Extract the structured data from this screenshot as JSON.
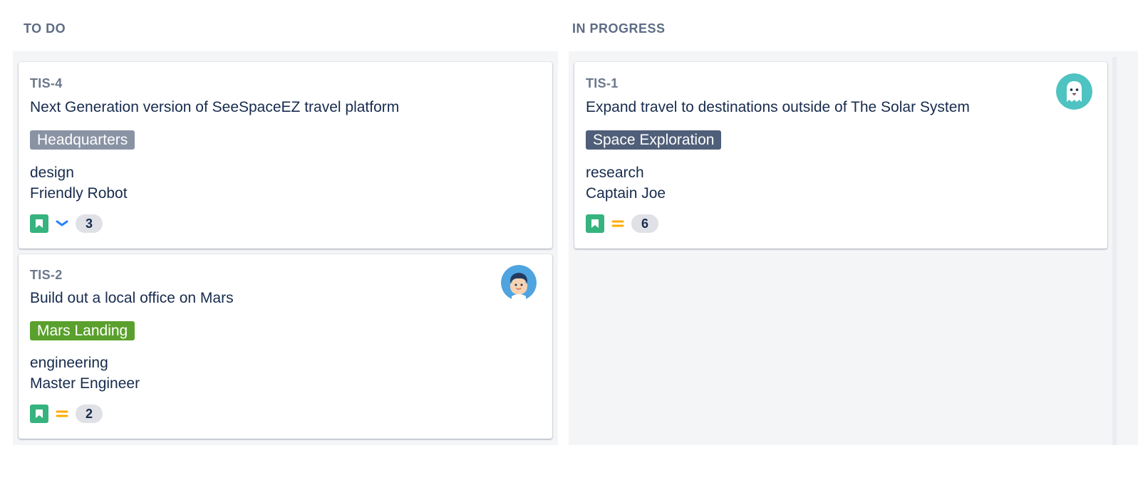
{
  "columns": [
    {
      "title": "TO DO",
      "cards": [
        {
          "key": "TIS-4",
          "summary": "Next Generation version of SeeSpaceEZ travel platform",
          "epic": "Headquarters",
          "epic_color": "#8993a4",
          "component": "design",
          "team": "Friendly Robot",
          "issue_type_icon": "story-icon",
          "priority_icon": "priority-low-icon",
          "estimate": "3"
        },
        {
          "key": "TIS-2",
          "summary": "Build out a local office on Mars",
          "epic": "Mars Landing",
          "epic_color": "#5aa02c",
          "component": "engineering",
          "team": "Master Engineer",
          "issue_type_icon": "story-icon",
          "priority_icon": "priority-medium-icon",
          "estimate": "2",
          "assignee_avatar": "person-avatar-icon"
        }
      ]
    },
    {
      "title": "IN PROGRESS",
      "cards": [
        {
          "key": "TIS-1",
          "summary": "Expand travel to destinations outside of The Solar System",
          "epic": "Space Exploration",
          "epic_color": "#505f79",
          "component": "research",
          "team": "Captain Joe",
          "issue_type_icon": "story-icon",
          "priority_icon": "priority-medium-icon",
          "estimate": "6",
          "assignee_avatar": "ghost-avatar-icon"
        }
      ]
    }
  ],
  "colors": {
    "column_bg": "#f4f5f7",
    "story_green": "#36b37e",
    "priority_low_blue": "#2684ff",
    "priority_medium_orange": "#ffab00"
  }
}
